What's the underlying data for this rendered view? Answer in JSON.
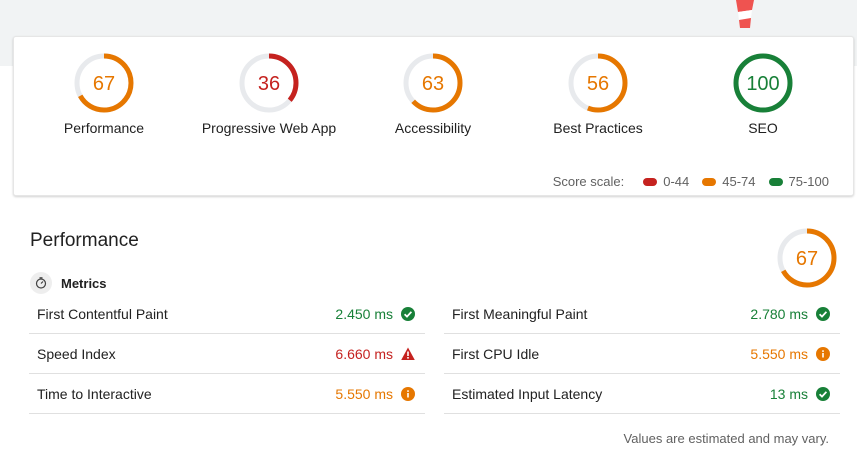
{
  "colors": {
    "pass": "#188038",
    "average": "#e67700",
    "fail": "#c5221f",
    "track": "#e8eaed"
  },
  "gauges": [
    {
      "label": "Performance",
      "score": "67",
      "fraction": 0.67,
      "status": "average",
      "icon": "score-gauge"
    },
    {
      "label": "Progressive Web App",
      "score": "36",
      "fraction": 0.36,
      "status": "fail",
      "icon": "score-gauge"
    },
    {
      "label": "Accessibility",
      "score": "63",
      "fraction": 0.63,
      "status": "average",
      "icon": "score-gauge"
    },
    {
      "label": "Best Practices",
      "score": "56",
      "fraction": 0.56,
      "status": "average",
      "icon": "score-gauge"
    },
    {
      "label": "SEO",
      "score": "100",
      "fraction": 1.0,
      "status": "pass",
      "icon": "score-gauge"
    }
  ],
  "scale": {
    "label": "Score scale:",
    "items": [
      {
        "range": "0-44",
        "status": "fail"
      },
      {
        "range": "45-74",
        "status": "average"
      },
      {
        "range": "75-100",
        "status": "pass"
      }
    ]
  },
  "performance": {
    "title": "Performance",
    "score": "67",
    "fraction": 0.67,
    "metrics_label": "Metrics",
    "metrics_icon": "timer-icon",
    "left": [
      {
        "name": "First Contentful Paint",
        "value": "2.450 ms",
        "status": "pass",
        "icon": "check-circle-icon"
      },
      {
        "name": "Speed Index",
        "value": "6.660 ms",
        "status": "fail",
        "icon": "warning-triangle-icon"
      },
      {
        "name": "Time to Interactive",
        "value": "5.550 ms",
        "status": "average",
        "icon": "info-circle-icon"
      }
    ],
    "right": [
      {
        "name": "First Meaningful Paint",
        "value": "2.780 ms",
        "status": "pass",
        "icon": "check-circle-icon"
      },
      {
        "name": "First CPU Idle",
        "value": "5.550 ms",
        "status": "average",
        "icon": "info-circle-icon"
      },
      {
        "name": "Estimated Input Latency",
        "value": "13 ms",
        "status": "pass",
        "icon": "check-circle-icon"
      }
    ],
    "footnote": "Values are estimated and may vary."
  }
}
